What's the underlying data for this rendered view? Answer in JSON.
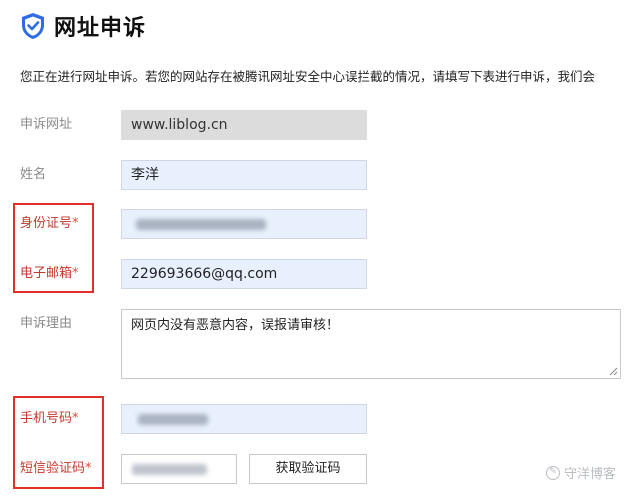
{
  "header": {
    "title": "网址申诉",
    "icon": "shield-check-icon",
    "accent": "#2e6be6"
  },
  "intro": "您正在进行网址申诉。若您的网站存在被腾讯网址安全中心误拦截的情况，请填写下表进行申诉，我们会",
  "form": {
    "url": {
      "label": "申诉网址",
      "value": "www.liblog.cn"
    },
    "name": {
      "label": "姓名",
      "value": "李洋"
    },
    "idcard": {
      "label": "身份证号",
      "star": "*"
    },
    "email": {
      "label": "电子邮箱",
      "star": "*",
      "value": "229693666@qq.com"
    },
    "reason": {
      "label": "申诉理由",
      "value": "网页内没有恶意内容，误报请审核！"
    },
    "phone": {
      "label": "手机号码",
      "star": "*"
    },
    "sms": {
      "label": "短信验证码",
      "star": "*",
      "button": "获取验证码"
    }
  },
  "watermark": "守洋博客"
}
